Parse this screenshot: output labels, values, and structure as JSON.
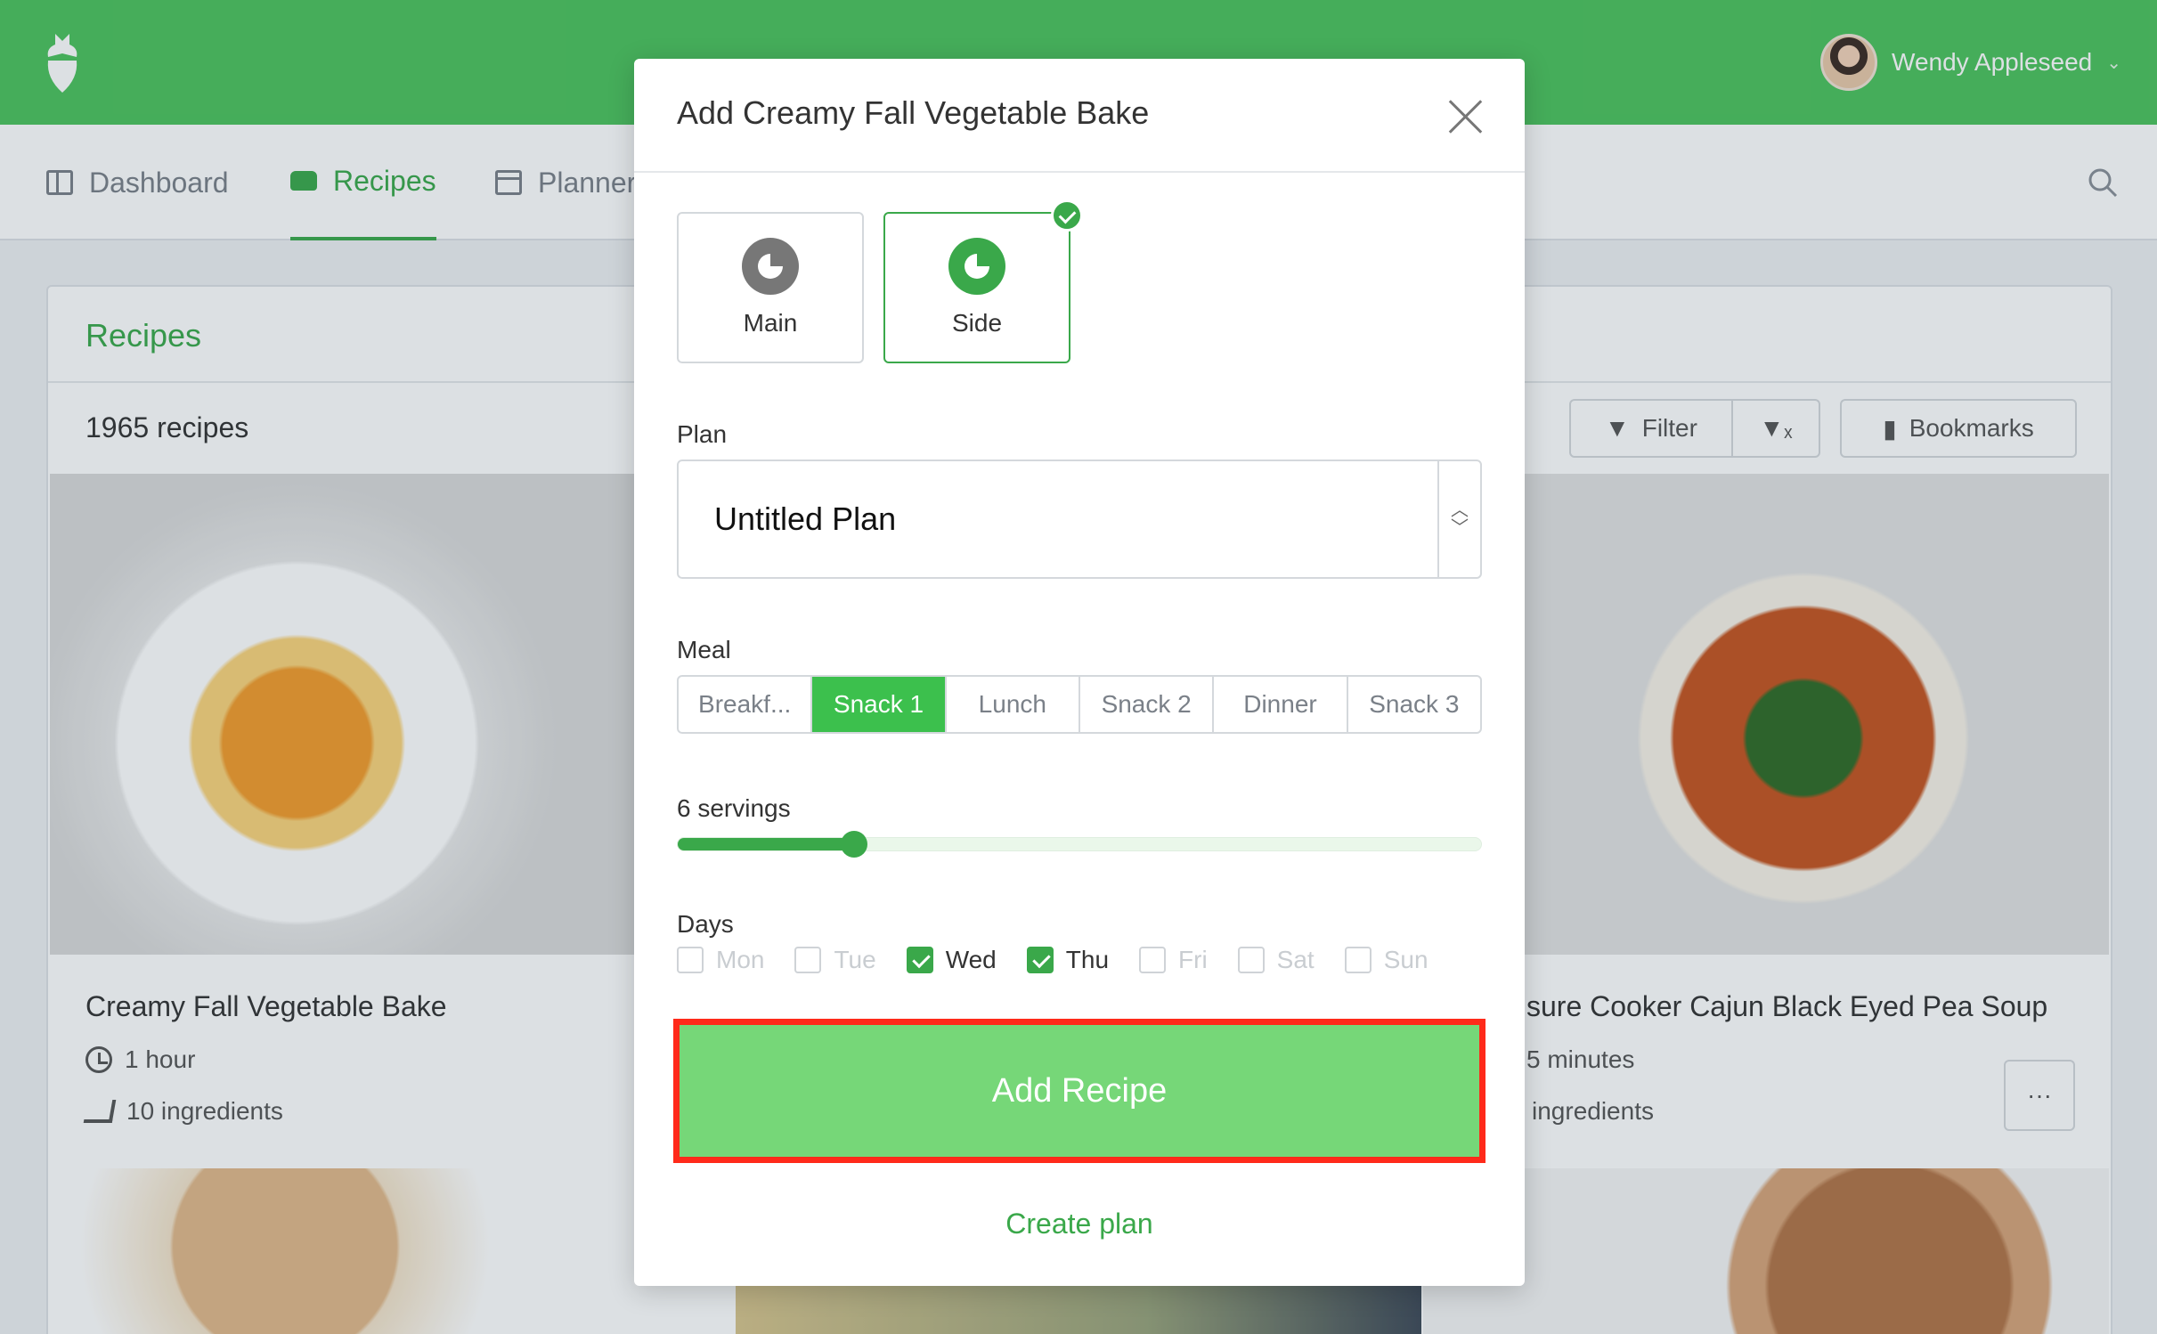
{
  "app": {
    "user_name": "Wendy Appleseed",
    "colors": {
      "brand_green": "#4cc35c",
      "accent_green": "#3aa84a",
      "highlight_red": "#ff2a1a"
    }
  },
  "nav": {
    "items": [
      {
        "label": "Dashboard",
        "icon": "dashboard-icon"
      },
      {
        "label": "Recipes",
        "icon": "tray-icon",
        "active": true
      },
      {
        "label": "Planner",
        "icon": "calendar-icon"
      }
    ]
  },
  "recipes_panel": {
    "title": "Recipes",
    "count": "1965 recipes",
    "filter_label": "Filter",
    "bookmarks_label": "Bookmarks",
    "cards": [
      {
        "title": "Creamy Fall Vegetable Bake",
        "time": "1 hour",
        "ingredients": "10 ingredients"
      },
      {
        "title": "sure Cooker Cajun Black Eyed Pea Soup",
        "time": "5 minutes",
        "ingredients": "ingredients"
      }
    ],
    "more_label": "···"
  },
  "modal": {
    "title": "Add Creamy Fall Vegetable Bake",
    "types": [
      {
        "label": "Main",
        "selected": false
      },
      {
        "label": "Side",
        "selected": true
      }
    ],
    "plan_label": "Plan",
    "plan_value": "Untitled Plan",
    "meal_label": "Meal",
    "meals": [
      "Breakf...",
      "Snack 1",
      "Lunch",
      "Snack 2",
      "Dinner",
      "Snack 3"
    ],
    "selected_meal": "Snack 1",
    "servings_label": "6 servings",
    "servings": {
      "value": 6,
      "fraction": 0.22
    },
    "days_label": "Days",
    "days": [
      {
        "label": "Mon",
        "checked": false
      },
      {
        "label": "Tue",
        "checked": false
      },
      {
        "label": "Wed",
        "checked": true
      },
      {
        "label": "Thu",
        "checked": true
      },
      {
        "label": "Fri",
        "checked": false
      },
      {
        "label": "Sat",
        "checked": false
      },
      {
        "label": "Sun",
        "checked": false
      }
    ],
    "add_button": "Add Recipe",
    "create_plan": "Create plan"
  }
}
